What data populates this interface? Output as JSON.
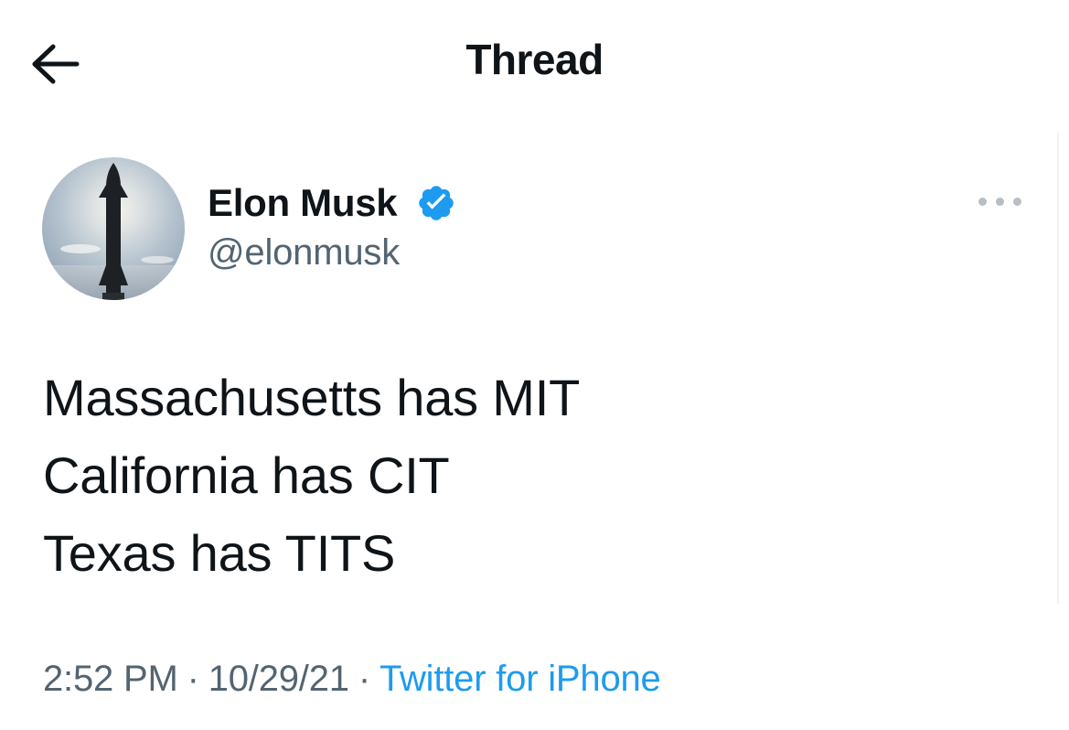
{
  "header": {
    "title": "Thread",
    "back_icon": "arrow-left-icon"
  },
  "tweet": {
    "author": {
      "name": "Elon Musk",
      "handle": "@elonmusk",
      "verified": true,
      "verified_color": "#1d9bf0",
      "avatar_icon": "avatar-rocket-image"
    },
    "more_icon": "more-horizontal-icon",
    "lines": [
      "Massachusetts has MIT",
      "California has CIT",
      "Texas has TITS"
    ],
    "time": "2:52 PM",
    "separator": "·",
    "date": "10/29/21",
    "source": "Twitter for iPhone"
  },
  "colors": {
    "text": "#0f1419",
    "secondary": "#536471",
    "link": "#1d9bf0",
    "more_dots": "#b7bec5"
  }
}
